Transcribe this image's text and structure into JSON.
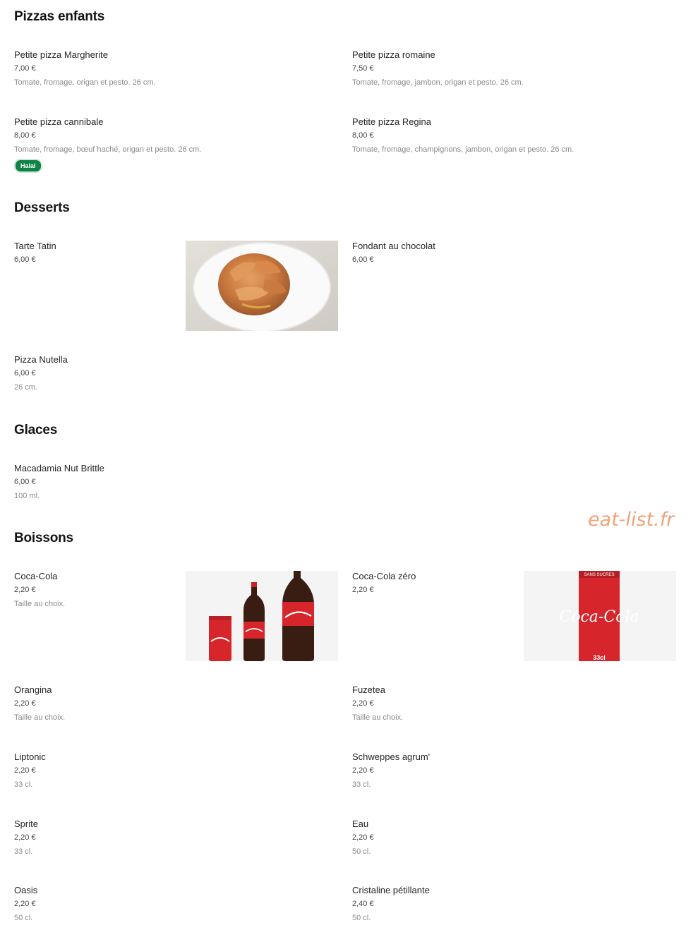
{
  "sections": {
    "pizzas_enfants": {
      "title": "Pizzas enfants",
      "items": [
        {
          "name": "Petite pizza Margherite",
          "price": "7,00 €",
          "desc": "Tomate, fromage, origan et pesto. 26 cm."
        },
        {
          "name": "Petite pizza romaine",
          "price": "7,50 €",
          "desc": "Tomate, fromage, jambon, origan et pesto. 26 cm."
        },
        {
          "name": "Petite pizza cannibale",
          "price": "8,00 €",
          "desc": "Tomate, fromage, bœuf haché, origan et pesto. 26 cm.",
          "badge": "Halal"
        },
        {
          "name": "Petite pizza Regina",
          "price": "8,00 €",
          "desc": "Tomate, fromage, champignons, jambon, origan et pesto. 26 cm."
        }
      ]
    },
    "desserts": {
      "title": "Desserts",
      "items": [
        {
          "name": "Tarte Tatin",
          "price": "6,00 €"
        },
        {
          "name": "Fondant au chocolat",
          "price": "6,00 €"
        },
        {
          "name": "Pizza Nutella",
          "price": "6,00 €",
          "desc": "26 cm."
        }
      ]
    },
    "glaces": {
      "title": "Glaces",
      "items": [
        {
          "name": "Macadamia Nut Brittle",
          "price": "6,00 €",
          "desc": "100 ml."
        }
      ]
    },
    "boissons": {
      "title": "Boissons",
      "items": [
        {
          "name": "Coca-Cola",
          "price": "2,20 €",
          "desc": "Taille au choix."
        },
        {
          "name": "Coca-Cola zéro",
          "price": "2,20 €"
        },
        {
          "name": "Orangina",
          "price": "2,20 €",
          "desc": "Taille au choix."
        },
        {
          "name": "Fuzetea",
          "price": "2,20 €",
          "desc": "Taille au choix."
        },
        {
          "name": "Liptonic",
          "price": "2,20 €",
          "desc": "33 cl."
        },
        {
          "name": "Schweppes agrum'",
          "price": "2,20 €",
          "desc": "33 cl."
        },
        {
          "name": "Sprite",
          "price": "2,20 €",
          "desc": "33 cl."
        },
        {
          "name": "Eau",
          "price": "2,20 €",
          "desc": "50 cl."
        },
        {
          "name": "Oasis",
          "price": "2,20 €",
          "desc": "50 cl."
        },
        {
          "name": "Cristaline pétillante",
          "price": "2,40 €",
          "desc": "50 cl."
        }
      ]
    }
  },
  "images": {
    "can_top_label": "SANS SUCRES",
    "can_brand": "Coca-Cola",
    "can_size": "33cl"
  },
  "watermark": "eat-list.fr",
  "colors": {
    "halal_badge": "#0e8345",
    "coke_red": "#d6262b",
    "watermark": "#f0a27a"
  }
}
